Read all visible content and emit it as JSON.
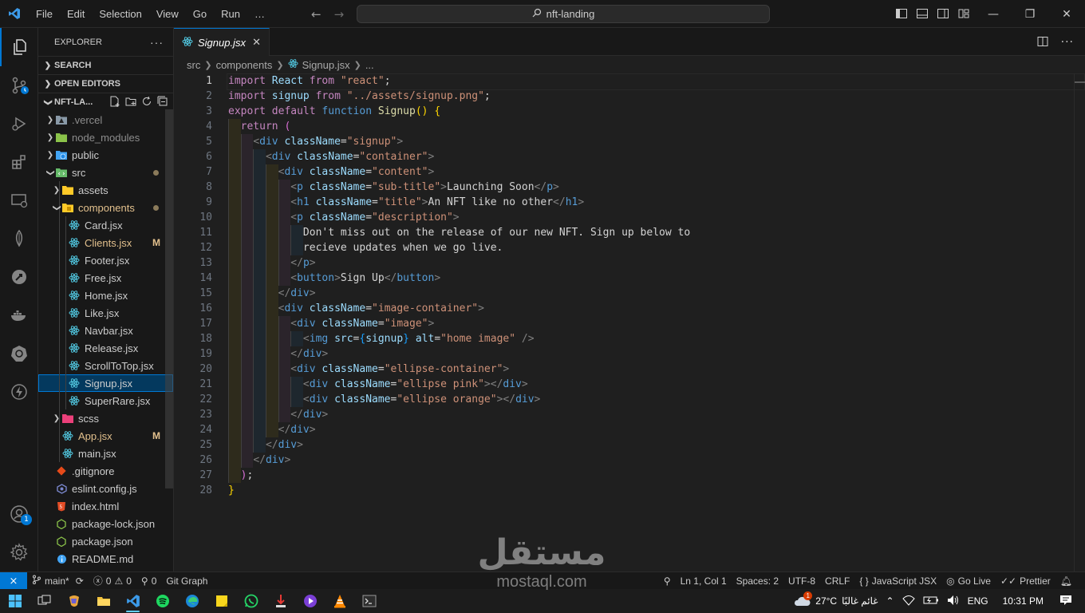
{
  "titlebar": {
    "menu": [
      "File",
      "Edit",
      "Selection",
      "View",
      "Go",
      "Run",
      "…"
    ],
    "search_text": "nft-landing"
  },
  "sidebar": {
    "title": "EXPLORER",
    "search_section": "SEARCH",
    "open_editors_section": "OPEN EDITORS",
    "project_section": "NFT-LA...",
    "tree": [
      {
        "name": ".vercel",
        "level": 1,
        "type": "folder",
        "expanded": false,
        "icon": "vercel-folder-icon"
      },
      {
        "name": "node_modules",
        "level": 1,
        "type": "folder",
        "expanded": false,
        "icon": "node-folder-icon"
      },
      {
        "name": "public",
        "level": 1,
        "type": "folder",
        "expanded": false,
        "icon": "public-folder-icon"
      },
      {
        "name": "src",
        "level": 1,
        "type": "folder",
        "expanded": true,
        "icon": "src-folder-icon",
        "git": "dot"
      },
      {
        "name": "assets",
        "level": 2,
        "type": "folder",
        "expanded": false,
        "icon": "assets-folder-icon"
      },
      {
        "name": "components",
        "level": 2,
        "type": "folder",
        "expanded": true,
        "icon": "components-folder-icon",
        "git": "dot",
        "mod": true
      },
      {
        "name": "Card.jsx",
        "level": 3,
        "type": "file",
        "icon": "react-icon"
      },
      {
        "name": "Clients.jsx",
        "level": 3,
        "type": "file",
        "icon": "react-icon",
        "git": "M",
        "mod": true
      },
      {
        "name": "Footer.jsx",
        "level": 3,
        "type": "file",
        "icon": "react-icon"
      },
      {
        "name": "Free.jsx",
        "level": 3,
        "type": "file",
        "icon": "react-icon"
      },
      {
        "name": "Home.jsx",
        "level": 3,
        "type": "file",
        "icon": "react-icon"
      },
      {
        "name": "Like.jsx",
        "level": 3,
        "type": "file",
        "icon": "react-icon"
      },
      {
        "name": "Navbar.jsx",
        "level": 3,
        "type": "file",
        "icon": "react-icon"
      },
      {
        "name": "Release.jsx",
        "level": 3,
        "type": "file",
        "icon": "react-icon"
      },
      {
        "name": "ScrollToTop.jsx",
        "level": 3,
        "type": "file",
        "icon": "react-icon"
      },
      {
        "name": "Signup.jsx",
        "level": 3,
        "type": "file",
        "icon": "react-icon",
        "selected": true
      },
      {
        "name": "SuperRare.jsx",
        "level": 3,
        "type": "file",
        "icon": "react-icon"
      },
      {
        "name": "scss",
        "level": 2,
        "type": "folder",
        "expanded": false,
        "icon": "scss-folder-icon"
      },
      {
        "name": "App.jsx",
        "level": 2,
        "type": "file",
        "icon": "react-icon",
        "git": "M",
        "mod": true
      },
      {
        "name": "main.jsx",
        "level": 2,
        "type": "file",
        "icon": "react-icon"
      },
      {
        "name": ".gitignore",
        "level": 1,
        "type": "file",
        "icon": "git-icon"
      },
      {
        "name": "eslint.config.js",
        "level": 1,
        "type": "file",
        "icon": "eslint-icon"
      },
      {
        "name": "index.html",
        "level": 1,
        "type": "file",
        "icon": "html-icon"
      },
      {
        "name": "package-lock.json",
        "level": 1,
        "type": "file",
        "icon": "node-json-icon"
      },
      {
        "name": "package.json",
        "level": 1,
        "type": "file",
        "icon": "node-json-icon"
      },
      {
        "name": "README.md",
        "level": 1,
        "type": "file",
        "icon": "info-icon"
      }
    ]
  },
  "editor": {
    "tab_label": "Signup.jsx",
    "breadcrumb": [
      "src",
      "components",
      "Signup.jsx",
      "..."
    ],
    "current_line": 1,
    "lines": [
      [
        [
          "k",
          "import"
        ],
        [
          "tx",
          " "
        ],
        [
          "v",
          "React"
        ],
        [
          "tx",
          " "
        ],
        [
          "k",
          "from"
        ],
        [
          "tx",
          " "
        ],
        [
          "s",
          "\"react\""
        ],
        [
          "tx",
          ";"
        ]
      ],
      [
        [
          "k",
          "import"
        ],
        [
          "tx",
          " "
        ],
        [
          "v",
          "signup"
        ],
        [
          "tx",
          " "
        ],
        [
          "k",
          "from"
        ],
        [
          "tx",
          " "
        ],
        [
          "s",
          "\"../assets/signup.png\""
        ],
        [
          "tx",
          ";"
        ]
      ],
      [
        [
          "k",
          "export"
        ],
        [
          "tx",
          " "
        ],
        [
          "k",
          "default"
        ],
        [
          "tx",
          " "
        ],
        [
          "kb",
          "function"
        ],
        [
          "tx",
          " "
        ],
        [
          "f",
          "Signup"
        ],
        [
          "br1",
          "()"
        ],
        [
          "tx",
          " "
        ],
        [
          "br1",
          "{"
        ]
      ],
      [
        [
          "tx",
          "  "
        ],
        [
          "k",
          "return"
        ],
        [
          "tx",
          " "
        ],
        [
          "br2",
          "("
        ]
      ],
      [
        [
          "tx",
          "    "
        ],
        [
          "tg",
          "<"
        ],
        [
          "t",
          "div"
        ],
        [
          "tx",
          " "
        ],
        [
          "a",
          "className"
        ],
        [
          "tx",
          "="
        ],
        [
          "s",
          "\"signup\""
        ],
        [
          "tg",
          ">"
        ]
      ],
      [
        [
          "tx",
          "      "
        ],
        [
          "tg",
          "<"
        ],
        [
          "t",
          "div"
        ],
        [
          "tx",
          " "
        ],
        [
          "a",
          "className"
        ],
        [
          "tx",
          "="
        ],
        [
          "s",
          "\"container\""
        ],
        [
          "tg",
          ">"
        ]
      ],
      [
        [
          "tx",
          "        "
        ],
        [
          "tg",
          "<"
        ],
        [
          "t",
          "div"
        ],
        [
          "tx",
          " "
        ],
        [
          "a",
          "className"
        ],
        [
          "tx",
          "="
        ],
        [
          "s",
          "\"content\""
        ],
        [
          "tg",
          ">"
        ]
      ],
      [
        [
          "tx",
          "          "
        ],
        [
          "tg",
          "<"
        ],
        [
          "t",
          "p"
        ],
        [
          "tx",
          " "
        ],
        [
          "a",
          "className"
        ],
        [
          "tx",
          "="
        ],
        [
          "s",
          "\"sub-title\""
        ],
        [
          "tg",
          ">"
        ],
        [
          "tx",
          "Launching Soon"
        ],
        [
          "tg",
          "</"
        ],
        [
          "t",
          "p"
        ],
        [
          "tg",
          ">"
        ]
      ],
      [
        [
          "tx",
          "          "
        ],
        [
          "tg",
          "<"
        ],
        [
          "t",
          "h1"
        ],
        [
          "tx",
          " "
        ],
        [
          "a",
          "className"
        ],
        [
          "tx",
          "="
        ],
        [
          "s",
          "\"title\""
        ],
        [
          "tg",
          ">"
        ],
        [
          "tx",
          "An NFT like no other"
        ],
        [
          "tg",
          "</"
        ],
        [
          "t",
          "h1"
        ],
        [
          "tg",
          ">"
        ]
      ],
      [
        [
          "tx",
          "          "
        ],
        [
          "tg",
          "<"
        ],
        [
          "t",
          "p"
        ],
        [
          "tx",
          " "
        ],
        [
          "a",
          "className"
        ],
        [
          "tx",
          "="
        ],
        [
          "s",
          "\"description\""
        ],
        [
          "tg",
          ">"
        ]
      ],
      [
        [
          "tx",
          "            Don't miss out on the release of our new NFT. Sign up below to"
        ]
      ],
      [
        [
          "tx",
          "            recieve updates when we go live."
        ]
      ],
      [
        [
          "tx",
          "          "
        ],
        [
          "tg",
          "</"
        ],
        [
          "t",
          "p"
        ],
        [
          "tg",
          ">"
        ]
      ],
      [
        [
          "tx",
          "          "
        ],
        [
          "tg",
          "<"
        ],
        [
          "t",
          "button"
        ],
        [
          "tg",
          ">"
        ],
        [
          "tx",
          "Sign Up"
        ],
        [
          "tg",
          "</"
        ],
        [
          "t",
          "button"
        ],
        [
          "tg",
          ">"
        ]
      ],
      [
        [
          "tx",
          "        "
        ],
        [
          "tg",
          "</"
        ],
        [
          "t",
          "div"
        ],
        [
          "tg",
          ">"
        ]
      ],
      [
        [
          "tx",
          "        "
        ],
        [
          "tg",
          "<"
        ],
        [
          "t",
          "div"
        ],
        [
          "tx",
          " "
        ],
        [
          "a",
          "className"
        ],
        [
          "tx",
          "="
        ],
        [
          "s",
          "\"image-container\""
        ],
        [
          "tg",
          ">"
        ]
      ],
      [
        [
          "tx",
          "          "
        ],
        [
          "tg",
          "<"
        ],
        [
          "t",
          "div"
        ],
        [
          "tx",
          " "
        ],
        [
          "a",
          "className"
        ],
        [
          "tx",
          "="
        ],
        [
          "s",
          "\"image\""
        ],
        [
          "tg",
          ">"
        ]
      ],
      [
        [
          "tx",
          "            "
        ],
        [
          "tg",
          "<"
        ],
        [
          "t",
          "img"
        ],
        [
          "tx",
          " "
        ],
        [
          "a",
          "src"
        ],
        [
          "tx",
          "="
        ],
        [
          "br3",
          "{"
        ],
        [
          "v",
          "signup"
        ],
        [
          "br3",
          "}"
        ],
        [
          "tx",
          " "
        ],
        [
          "a",
          "alt"
        ],
        [
          "tx",
          "="
        ],
        [
          "s",
          "\"home image\""
        ],
        [
          "tx",
          " "
        ],
        [
          "tg",
          "/>"
        ]
      ],
      [
        [
          "tx",
          "          "
        ],
        [
          "tg",
          "</"
        ],
        [
          "t",
          "div"
        ],
        [
          "tg",
          ">"
        ]
      ],
      [
        [
          "tx",
          "          "
        ],
        [
          "tg",
          "<"
        ],
        [
          "t",
          "div"
        ],
        [
          "tx",
          " "
        ],
        [
          "a",
          "className"
        ],
        [
          "tx",
          "="
        ],
        [
          "s",
          "\"ellipse-container\""
        ],
        [
          "tg",
          ">"
        ]
      ],
      [
        [
          "tx",
          "            "
        ],
        [
          "tg",
          "<"
        ],
        [
          "t",
          "div"
        ],
        [
          "tx",
          " "
        ],
        [
          "a",
          "className"
        ],
        [
          "tx",
          "="
        ],
        [
          "s",
          "\"ellipse pink\""
        ],
        [
          "tg",
          "></"
        ],
        [
          "t",
          "div"
        ],
        [
          "tg",
          ">"
        ]
      ],
      [
        [
          "tx",
          "            "
        ],
        [
          "tg",
          "<"
        ],
        [
          "t",
          "div"
        ],
        [
          "tx",
          " "
        ],
        [
          "a",
          "className"
        ],
        [
          "tx",
          "="
        ],
        [
          "s",
          "\"ellipse orange\""
        ],
        [
          "tg",
          "></"
        ],
        [
          "t",
          "div"
        ],
        [
          "tg",
          ">"
        ]
      ],
      [
        [
          "tx",
          "          "
        ],
        [
          "tg",
          "</"
        ],
        [
          "t",
          "div"
        ],
        [
          "tg",
          ">"
        ]
      ],
      [
        [
          "tx",
          "        "
        ],
        [
          "tg",
          "</"
        ],
        [
          "t",
          "div"
        ],
        [
          "tg",
          ">"
        ]
      ],
      [
        [
          "tx",
          "      "
        ],
        [
          "tg",
          "</"
        ],
        [
          "t",
          "div"
        ],
        [
          "tg",
          ">"
        ]
      ],
      [
        [
          "tx",
          "    "
        ],
        [
          "tg",
          "</"
        ],
        [
          "t",
          "div"
        ],
        [
          "tg",
          ">"
        ]
      ],
      [
        [
          "tx",
          "  "
        ],
        [
          "br2",
          ")"
        ],
        [
          "tx",
          ";"
        ]
      ],
      [
        [
          "br1",
          "}"
        ]
      ]
    ]
  },
  "statusbar": {
    "branch": "main*",
    "errors": "0",
    "warnings": "0",
    "ports": "0",
    "git_graph": "Git Graph",
    "position": "Ln 1, Col 1",
    "spaces": "Spaces: 2",
    "encoding": "UTF-8",
    "eol": "CRLF",
    "language": "JavaScript JSX",
    "go_live": "Go Live",
    "prettier": "Prettier"
  },
  "taskbar": {
    "weather_temp": "27°C",
    "weather_text": "غائم غالبًا",
    "lang": "ENG",
    "time": "10:31 PM",
    "weather_badge": "1"
  },
  "activitybar": {
    "accounts_badge": "1"
  },
  "watermark": {
    "arabic": "مستقل",
    "latin": "mostaql.com"
  }
}
